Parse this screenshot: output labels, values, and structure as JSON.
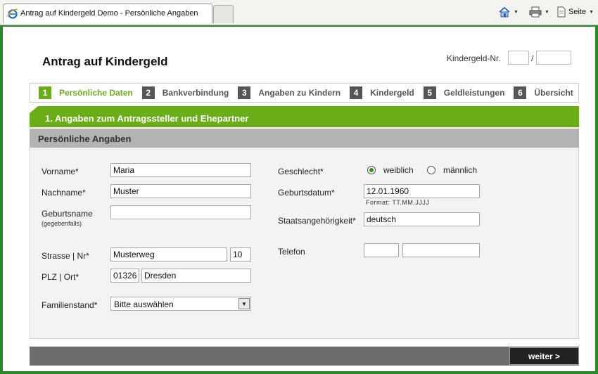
{
  "browser": {
    "tab_title": "Antrag auf Kindergeld Demo - Persönliche Angaben",
    "page_menu_label": "Seite"
  },
  "header": {
    "title": "Antrag auf Kindergeld",
    "kindergeld_nr_label": "Kindergeld-Nr.",
    "separator": "/"
  },
  "steps": [
    {
      "num": "1",
      "label": "Persönliche Daten",
      "active": true
    },
    {
      "num": "2",
      "label": "Bankverbindung"
    },
    {
      "num": "3",
      "label": "Angaben zu Kindern"
    },
    {
      "num": "4",
      "label": "Kindergeld"
    },
    {
      "num": "5",
      "label": "Geldleistungen"
    },
    {
      "num": "6",
      "label": "Übersicht"
    }
  ],
  "section": {
    "title": "1. Angaben zum Antragssteller und Ehepartner",
    "subtitle": "Persönliche Angaben"
  },
  "form": {
    "vorname": {
      "label": "Vorname*",
      "value": "Maria"
    },
    "nachname": {
      "label": "Nachname*",
      "value": "Muster"
    },
    "geburtsname": {
      "label": "Geburtsname",
      "sublabel": "(gegebenfalls)",
      "value": ""
    },
    "strasse": {
      "label": "Strasse | Nr*",
      "value": "Musterweg",
      "nr": "10"
    },
    "plz_ort": {
      "label": "PLZ | Ort*",
      "plz": "01326",
      "ort": "Dresden"
    },
    "familienstand": {
      "label": "Familienstand*",
      "value": "Bitte auswählen"
    },
    "geschlecht": {
      "label": "Geschlecht*",
      "options": [
        "weiblich",
        "männlich"
      ],
      "selected": "weiblich"
    },
    "geburtsdatum": {
      "label": "Geburtsdatum*",
      "value": "12.01.1960",
      "hint": "Format: TT.MM.JJJJ"
    },
    "staatsangehoerigkeit": {
      "label": "Staatsangehörigkeit*",
      "value": "deutsch"
    },
    "telefon": {
      "label": "Telefon",
      "vorwahl": "",
      "nummer": ""
    }
  },
  "footer": {
    "next_label": "weiter >"
  },
  "colors": {
    "accent": "#6aad17",
    "frame": "#2a8a2a"
  }
}
